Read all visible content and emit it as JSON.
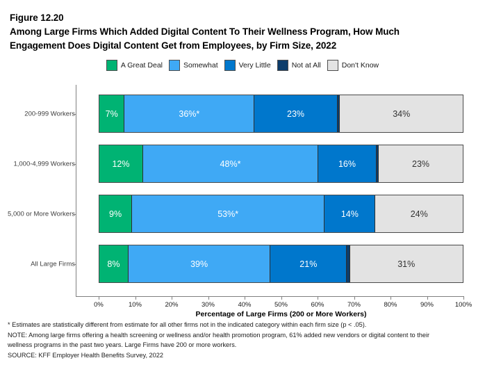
{
  "title": {
    "line1": "Figure 12.20",
    "line2": "Among Large Firms Which Added Digital Content To Their Wellness Program, How Much",
    "line3": "Engagement Does Digital Content Get from Employees, by Firm Size, 2022"
  },
  "legend": [
    {
      "label": "A Great Deal",
      "color": "#00b373"
    },
    {
      "label": "Somewhat",
      "color": "#3fa9f5"
    },
    {
      "label": "Very Little",
      "color": "#0077cc"
    },
    {
      "label": "Not at All",
      "color": "#0d3d6b"
    },
    {
      "label": "Don't Know",
      "color": "#e3e3e3"
    }
  ],
  "axis": {
    "x_title": "Percentage of Large Firms (200 or More Workers)",
    "x_ticks": [
      "0%",
      "10%",
      "20%",
      "30%",
      "40%",
      "50%",
      "60%",
      "70%",
      "80%",
      "90%",
      "100%"
    ],
    "x_min": 0,
    "x_max": 100
  },
  "footnotes": {
    "line1": "* Estimates are statistically different from estimate for all other firms not in the indicated category within each firm size (p < .05).",
    "line2": "NOTE: Among large firms offering a health screening or wellness and/or health promotion program, 61% added new vendors or digital content to their",
    "line3": "wellness programs in the past two years. Large Firms have 200 or more workers.",
    "line4": "SOURCE: KFF Employer Health Benefits Survey, 2022"
  },
  "chart_data": {
    "type": "bar",
    "orientation": "horizontal",
    "stacked": true,
    "normalized_percent": true,
    "title": "Among Large Firms Which Added Digital Content To Their Wellness Program, How Much Engagement Does Digital Content Get from Employees, by Firm Size, 2022",
    "xlabel": "Percentage of Large Firms (200 or More Workers)",
    "ylabel": "",
    "xlim": [
      0,
      100
    ],
    "grid": false,
    "legend_position": "top",
    "categories": [
      "200-999 Workers",
      "1,000-4,999 Workers",
      "5,000 or More Workers",
      "All Large Firms"
    ],
    "series": [
      {
        "name": "A Great Deal",
        "color": "#00b373",
        "values": [
          7,
          12,
          9,
          8
        ],
        "labels": [
          "7%",
          "12%",
          "9%",
          "8%"
        ]
      },
      {
        "name": "Somewhat",
        "color": "#3fa9f5",
        "values": [
          36,
          48,
          53,
          39
        ],
        "labels": [
          "36%*",
          "48%*",
          "53%*",
          "39%"
        ]
      },
      {
        "name": "Very Little",
        "color": "#0077cc",
        "values": [
          23,
          16,
          14,
          21
        ],
        "labels": [
          "23%",
          "16%",
          "14%",
          "21%"
        ]
      },
      {
        "name": "Not at All",
        "color": "#0d3d6b",
        "values": [
          0.7,
          0.6,
          0,
          0.8
        ],
        "labels": [
          "",
          "",
          "",
          ""
        ]
      },
      {
        "name": "Don't Know",
        "color": "#e3e3e3",
        "values": [
          34,
          23,
          24,
          31
        ],
        "labels": [
          "34%",
          "23%",
          "24%",
          "31%"
        ]
      }
    ],
    "annotations": [
      "* denotes statistically different estimate (p < .05)"
    ]
  }
}
